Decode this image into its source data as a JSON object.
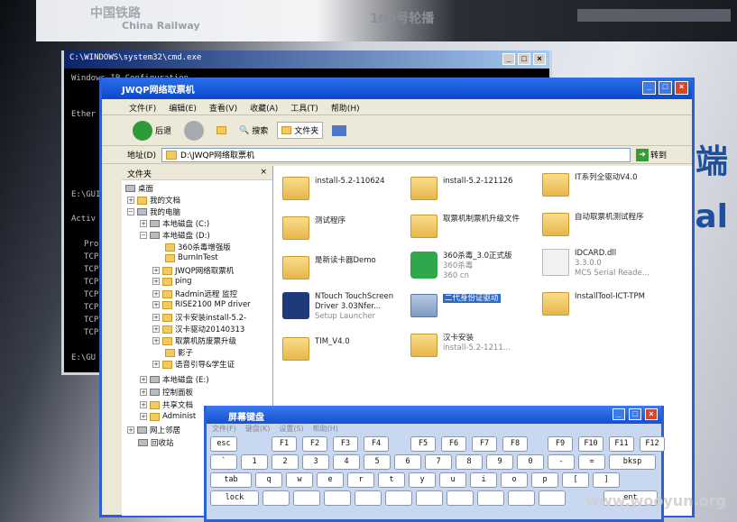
{
  "background": {
    "logo": "中国铁路",
    "logo_sub": "China Railway",
    "nav": "100号轮播",
    "side_text_1": "端",
    "side_text_2": "al"
  },
  "cmd": {
    "title": "C:\\WINDOWS\\system32\\cmd.exe",
    "lines": [
      "Windows IP Configuration",
      "Ether",
      "E:\\GUI",
      "Activ",
      "Pro",
      "TCP",
      "TCP",
      "TCP",
      "TCP",
      "TCP",
      "TCP",
      "TCP",
      "E:\\GU"
    ]
  },
  "explorer": {
    "title": "JWQP网络取票机",
    "menu": [
      "文件(F)",
      "编辑(E)",
      "查看(V)",
      "收藏(A)",
      "工具(T)",
      "帮助(H)"
    ],
    "toolbar": {
      "back": "后退",
      "search": "搜索",
      "folders": "文件夹"
    },
    "address_label": "地址(D)",
    "address_value": "D:\\JWQP网络取票机",
    "go": "转到",
    "tree_header": "文件夹",
    "tree": [
      "桌面",
      "我的文档",
      "我的电脑",
      "本地磁盘 (C:)",
      "本地磁盘 (D:)",
      "360杀毒增强版",
      "BurnInTest",
      "JWQP网络取票机",
      "ping",
      "Radmin远程 监控",
      "RISE2100 MP driver",
      "汉卡安装install-5.2-",
      "汉卡驱动20140313",
      "取票机防废票升级",
      "影子",
      "语音引导&学生证",
      "本地磁盘 (E:)",
      "控制面板",
      "共享文档",
      "Administ",
      "网上邻居",
      "回收站"
    ],
    "items": [
      {
        "name": "install-5.2-110624",
        "sub": ""
      },
      {
        "name": "install-5.2-121126",
        "sub": ""
      },
      {
        "name": "IT系列全驱动V4.0",
        "sub": ""
      },
      {
        "name": "测试程序",
        "sub": ""
      },
      {
        "name": "取票机制票机升级文件",
        "sub": ""
      },
      {
        "name": "自动取票机测试程序",
        "sub": ""
      },
      {
        "name": "是新读卡器Demo",
        "sub": ""
      },
      {
        "name": "360杀毒_3.0正式版",
        "sub": "360杀毒\n360 cn"
      },
      {
        "name": "IDCARD.dll",
        "sub": "3.3.0.0\nMCS Serial Reade..."
      },
      {
        "name": "NTouch TouchScreen Driver 3.03Nfer...",
        "sub": "Setup Launcher"
      },
      {
        "name": "二代身份证驱动",
        "sub": ""
      },
      {
        "name": "InstallTool-ICT-TPM",
        "sub": ""
      },
      {
        "name": "TIM_V4.0",
        "sub": ""
      },
      {
        "name": "汉卡安装",
        "sub": "install-5.2-1211..."
      }
    ]
  },
  "osk": {
    "title": "屏幕键盘",
    "menu": [
      "文件(F)",
      "键盘(K)",
      "设置(S)",
      "帮助(H)"
    ],
    "row1": [
      "esc",
      "F1",
      "F2",
      "F3",
      "F4",
      "F5",
      "F6",
      "F7",
      "F8",
      "F9",
      "F10",
      "F11",
      "F12"
    ],
    "row2": [
      "`",
      "1",
      "2",
      "3",
      "4",
      "5",
      "6",
      "7",
      "8",
      "9",
      "0",
      "-",
      "=",
      "bksp"
    ],
    "row3": [
      "tab",
      "q",
      "w",
      "e",
      "r",
      "t",
      "y",
      "u",
      "i",
      "o",
      "p",
      "[",
      "]"
    ],
    "row4": [
      "lock",
      "",
      "",
      "",
      "",
      "",
      "",
      "",
      "",
      "",
      "",
      "ent"
    ]
  },
  "watermark": "www.wooyun.org"
}
